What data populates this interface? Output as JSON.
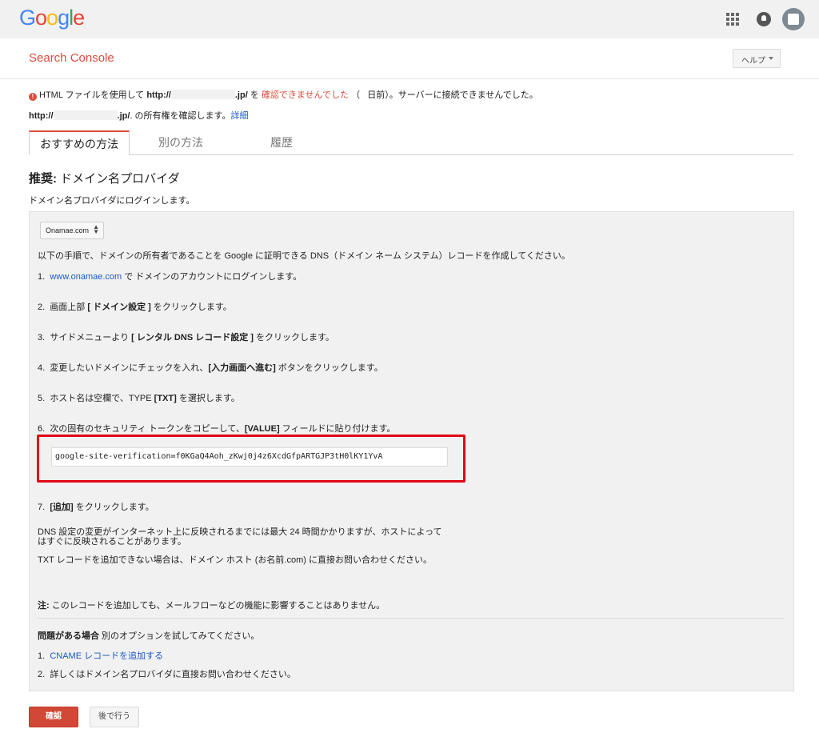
{
  "topbar": {
    "logo_letters": [
      {
        "ch": "G",
        "color": "#4285F4"
      },
      {
        "ch": "o",
        "color": "#EA4335"
      },
      {
        "ch": "o",
        "color": "#FBBC05"
      },
      {
        "ch": "g",
        "color": "#4285F4"
      },
      {
        "ch": "l",
        "color": "#34A853"
      },
      {
        "ch": "e",
        "color": "#EA4335"
      }
    ],
    "icons": [
      "apps-grid-icon",
      "notifications-bell-icon",
      "account-avatar-icon"
    ]
  },
  "header": {
    "title": "Search Console",
    "help_label": "ヘルプ"
  },
  "status": {
    "prefix": "HTML ファイルを使用して",
    "url_start": "http://",
    "url_end": ".jp/",
    "connector": "を",
    "failed_text": "確認できませんでした",
    "paren_open": "（",
    "days_text": "日前）。サーバーに接続できませんでした。",
    "site_url_start": "http://",
    "site_url_end": ".jp/",
    "ownership_text": ". の所有権を確認します。",
    "details_link": "詳細"
  },
  "tabs": [
    {
      "label": "おすすめの方法",
      "active": true
    },
    {
      "label": "別の方法",
      "active": false
    },
    {
      "label": "履歴",
      "active": false
    }
  ],
  "recommended": {
    "title_bold": "推奨:",
    "title_text": " ドメイン名プロバイダ",
    "subtitle": "ドメイン名プロバイダにログインします。"
  },
  "panel": {
    "provider_selected": "Onamae.com",
    "intro": "以下の手順で、ドメインの所有者であることを Google に証明できる DNS（ドメイン ネーム システム）レコードを作成してください。",
    "step1_num": "1.",
    "step1_link": "www.onamae.com",
    "step1_text": " で ドメインのアカウントにログインします。",
    "step2_num": "2.",
    "step2_pre": "画面上部 ",
    "step2_bold": "[ ドメイン設定 ]",
    "step2_post": " をクリックします。",
    "step3_num": "3.",
    "step3_pre": "サイドメニューより ",
    "step3_bold": "[ レンタル DNS レコード設定 ]",
    "step3_post": " をクリックします。",
    "step4_num": "4.",
    "step4_pre": "変更したいドメインにチェックを入れ、",
    "step4_bold": "[入力画面へ進む]",
    "step4_post": " ボタンをクリックします。",
    "step5_num": "5.",
    "step5_pre": "ホスト名は空欄で、TYPE ",
    "step5_bold": "[TXT]",
    "step5_post": " を選択します。",
    "step6_num": "6.",
    "step6_pre": "次の固有のセキュリティ トークンをコピーして、",
    "step6_bold": "[VALUE]",
    "step6_post": " フィールドに貼り付けます。",
    "token": "google-site-verification=f0KGaQ4Aoh_zKwj0j4z6XcdGfpARTGJP3tH0lKY1YvA",
    "step7_num": "7.",
    "step7_bold": "[追加]",
    "step7_post": " をクリックします。",
    "dns_note_line1": "DNS 設定の変更がインターネット上に反映されるまでには最大 24 時間かかりますが、ホストによって",
    "dns_note_line2": "はすぐに反映されることがあります。",
    "txt_note": "TXT レコードを追加できない場合は、ドメイン ホスト (お名前.com) に直接お問い合わせください。",
    "note_bold": "注:",
    "note_text": " このレコードを追加しても、メールフローなどの機能に影響することはありません。",
    "problem_bold": "問題がある場合",
    "problem_text": " 別のオプションを試してみてください。",
    "alt1_num": "1.",
    "alt1_link": "CNAME レコードを追加する",
    "alt2_num": "2.",
    "alt2_text": "詳しくはドメイン名プロバイダに直接お問い合わせください。"
  },
  "actions": {
    "confirm_label": "確認",
    "later_label": "後で行う"
  },
  "colors": {
    "accent": "#dd4b39",
    "link": "#1a59c9",
    "highlight_border": "#e30613"
  }
}
